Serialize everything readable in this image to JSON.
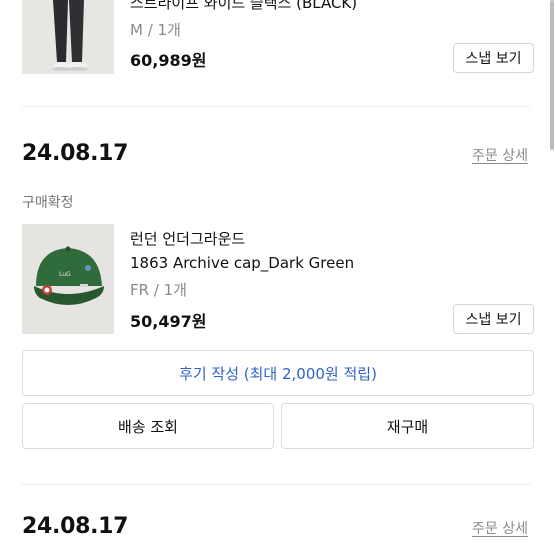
{
  "order1": {
    "product_name": "스트라이프 와이드 슬랙스 (BLACK)",
    "option": "M / 1개",
    "price": "60,989원",
    "snap_button": "스냅 보기"
  },
  "order2": {
    "date": "24.08.17",
    "detail_link": "주문 상세",
    "status": "구매확정",
    "brand": "런던 언더그라운드",
    "product_name": "1863 Archive cap_Dark Green",
    "option": "FR / 1개",
    "price": "50,497원",
    "snap_button": "스냅 보기",
    "review_button": "후기 작성 (최대 2,000원 적립)",
    "shipping_button": "배송 조회",
    "reorder_button": "재구매"
  },
  "order3": {
    "date": "24.08.17",
    "detail_link": "주문 상세"
  },
  "colors": {
    "review_text": "#2f62c9",
    "cap_green": "#2f6b3b"
  }
}
